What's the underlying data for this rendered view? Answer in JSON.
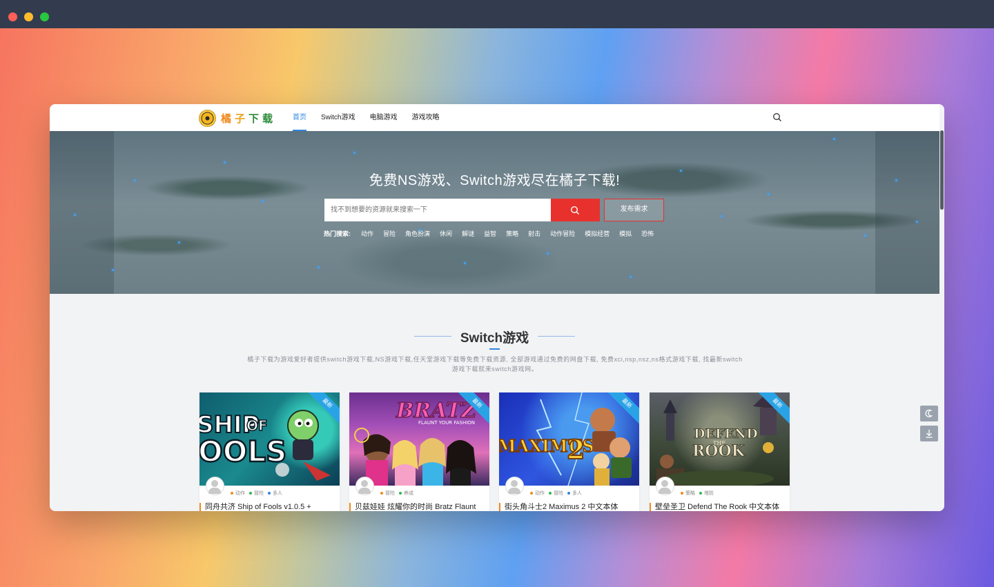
{
  "window_controls": [
    "close",
    "minimize",
    "maximize"
  ],
  "site": {
    "logo_text": [
      "橘",
      "子",
      "下",
      "载"
    ]
  },
  "nav": {
    "items": [
      {
        "label": "首页",
        "active": true
      },
      {
        "label": "Switch游戏",
        "active": false
      },
      {
        "label": "电脑游戏",
        "active": false
      },
      {
        "label": "游戏攻略",
        "active": false
      }
    ],
    "search_icon": "search-icon"
  },
  "hero": {
    "title": "免费NS游戏、Switch游戏尽在橘子下载!",
    "search_placeholder": "找不到想要的资源就来搜索一下",
    "search_button_icon": "search-icon",
    "request_button": "发布需求",
    "hot_label": "热门搜索:",
    "hot_tags": [
      "动作",
      "冒险",
      "角色扮演",
      "休闲",
      "解谜",
      "益智",
      "策略",
      "射击",
      "动作冒险",
      "模拟经营",
      "模拟",
      "恐怖"
    ]
  },
  "section": {
    "title": "Switch游戏",
    "description_line1": "橘子下载为游戏爱好者提供switch游戏下载,NS游戏下载,任天堂游戏下载等免费下载资源, 全部游戏通过免费的网盘下载, 免费xci,nsp,nsz,ns格式游戏下载, 找最新switch",
    "description_line2": "游戏下载就来switch游戏网。"
  },
  "cards": [
    {
      "ribbon": "最新",
      "cover_text": "SHIP OF FOOLS",
      "tags": [
        {
          "label": "动作",
          "color": "#f08a1c"
        },
        {
          "label": "冒险",
          "color": "#2eb84a"
        },
        {
          "label": "多人",
          "color": "#2f86e0"
        }
      ],
      "title": "同舟共济 Ship of Fools v1.0.5 +"
    },
    {
      "ribbon": "最新",
      "cover_text": "BRATZ",
      "tags": [
        {
          "label": "冒险",
          "color": "#f08a1c"
        },
        {
          "label": "养成",
          "color": "#2eb84a"
        }
      ],
      "title": "贝兹娃娃 炫耀你的时尚 Bratz Flaunt"
    },
    {
      "ribbon": "最新",
      "cover_text": "MAXIMUS 2",
      "tags": [
        {
          "label": "动作",
          "color": "#f08a1c"
        },
        {
          "label": "冒险",
          "color": "#2eb84a"
        },
        {
          "label": "多人",
          "color": "#2f86e0"
        }
      ],
      "title": "街头角斗士2 Maximus 2 中文本体"
    },
    {
      "ribbon": "最新",
      "cover_text": "DEFEND THE ROOK",
      "tags": [
        {
          "label": "策略",
          "color": "#f08a1c"
        },
        {
          "label": "塔防",
          "color": "#2eb84a"
        }
      ],
      "title": "壁垒圣卫 Defend The Rook 中文本体"
    }
  ],
  "floating": {
    "dark_mode_icon": "moon-icon",
    "download_icon": "download-icon"
  },
  "colors": {
    "accent": "#2f86e0",
    "search_red": "#e8312c",
    "ribbon_blue": "#2aa3e6",
    "title_bar": "#333c4e"
  }
}
